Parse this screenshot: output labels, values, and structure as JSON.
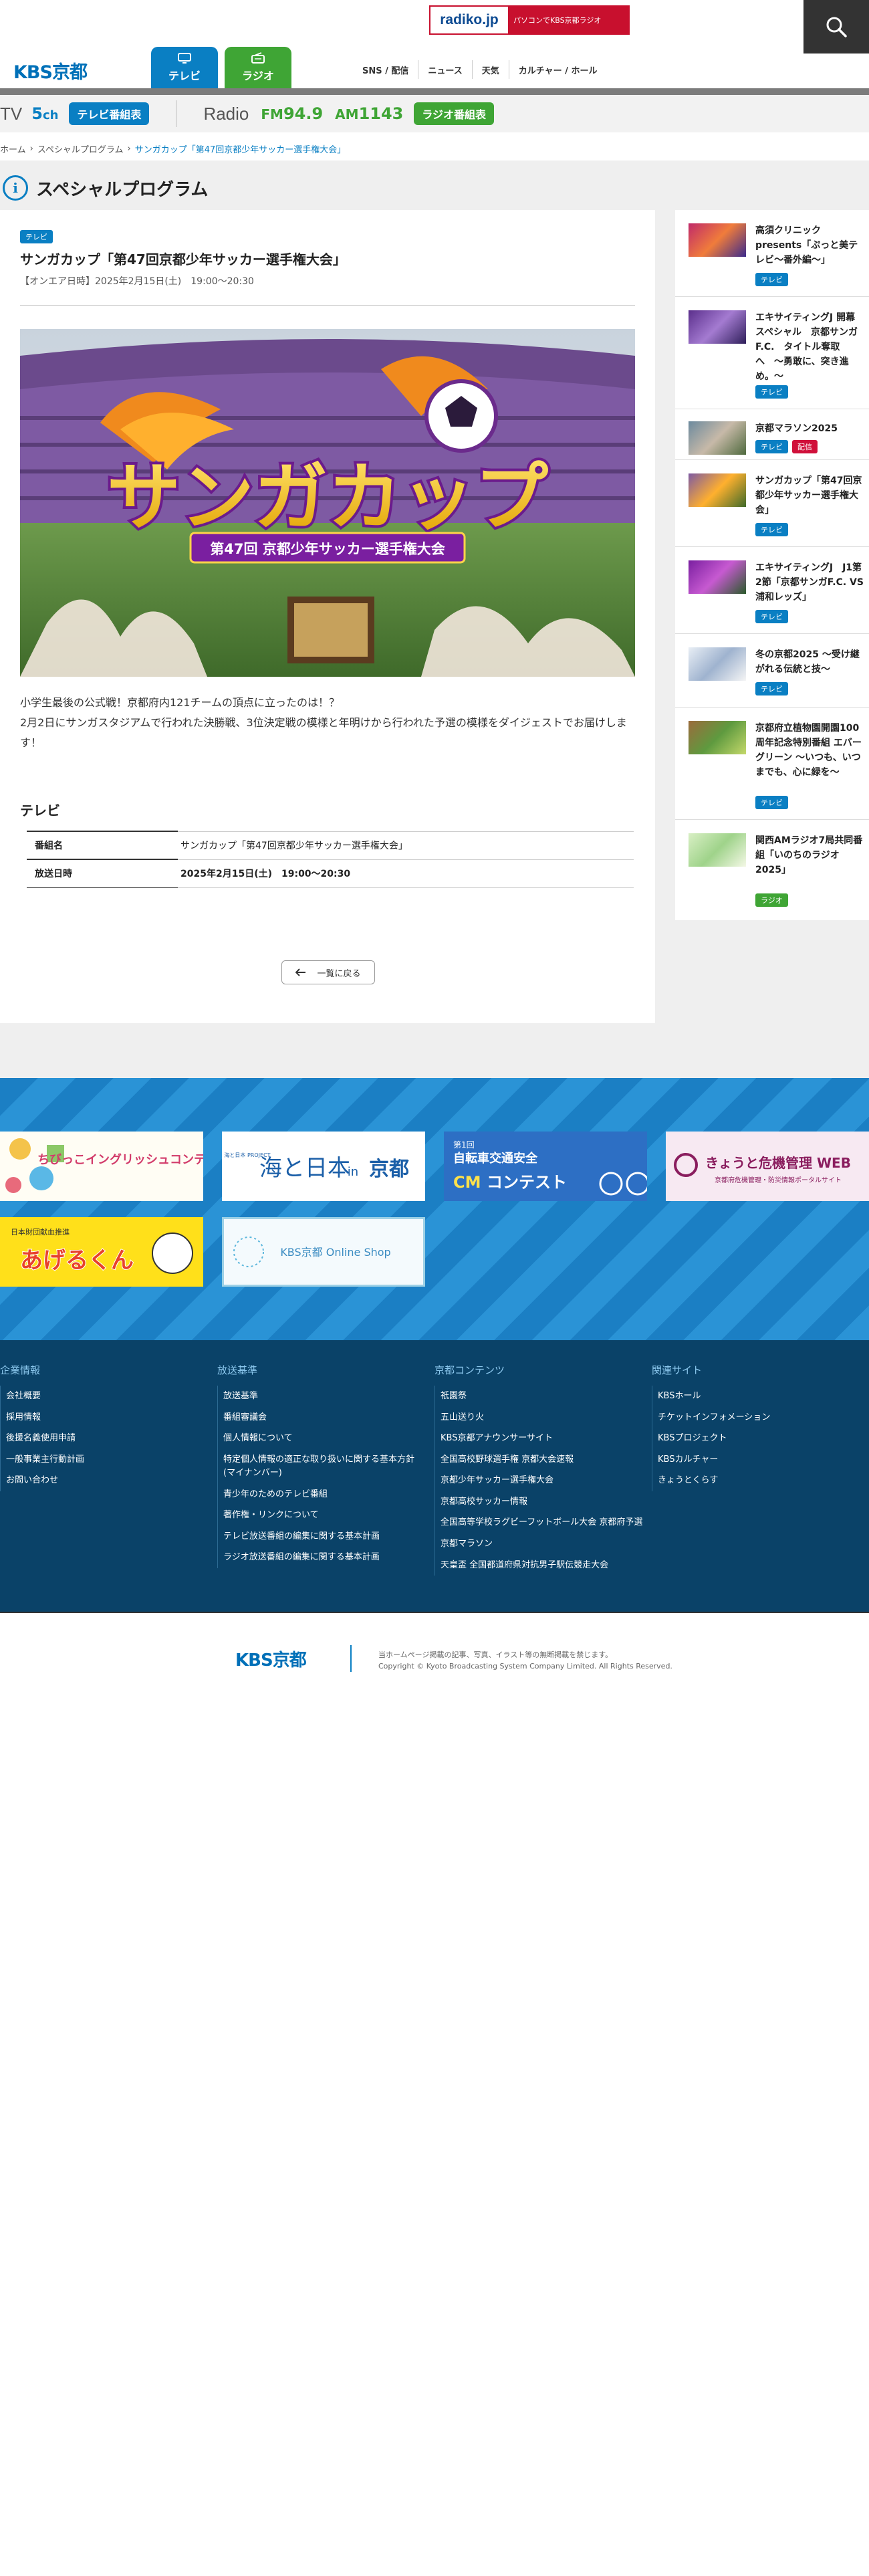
{
  "header": {
    "radiko_logo": "radiko.jp",
    "radiko_text": "パソコンでKBS京都ラジオ",
    "logo": "KBS京都",
    "tab_tv": "テレビ",
    "tab_radio": "ラジオ",
    "gnav": [
      "SNS / 配信",
      "ニュース",
      "天気",
      "カルチャー / ホール"
    ]
  },
  "channel": {
    "tv_label": "TV",
    "tv_channel": "5",
    "tv_channel_unit": "ch",
    "tv_schedule": "テレビ番組表",
    "radio_label": "Radio",
    "fm_label": "FM",
    "fm_freq": "94.9",
    "am_label": "AM",
    "am_freq": "1143",
    "radio_schedule": "ラジオ番組表"
  },
  "breadcrumb": {
    "home": "ホーム",
    "category": "スペシャルプログラム",
    "current": "サンガカップ「第47回京都少年サッカー選手権大会」"
  },
  "section_title": "スペシャルプログラム",
  "article": {
    "tag": "テレビ",
    "title": "サンガカップ「第47回京都少年サッカー選手権大会」",
    "air_date": "【オンエア日時】2025年2月15日(土)　19:00〜20:30",
    "hero_title": "サンガカップ",
    "hero_subtitle": "第47回 京都少年サッカー選手権大会",
    "desc_1": "小学生最後の公式戦！京都府内121チームの頂点に立ったのは！？",
    "desc_2": "2月2日にサンガスタジアムで行われた決勝戦、3位決定戦の模様と年明けから行われた予選の模様をダイジェストでお届けします！",
    "tv_heading": "テレビ",
    "table": [
      {
        "label": "番組名",
        "value": "サンガカップ「第47回京都少年サッカー選手権大会」"
      },
      {
        "label": "放送日時",
        "value": "2025年2月15日(土)　19:00〜20:30"
      }
    ],
    "back": "一覧に戻る"
  },
  "sidebar": [
    {
      "title": "高須クリニック presents「ぷっと美テレビ〜番外編〜」",
      "tags": [
        "テレビ"
      ]
    },
    {
      "title": "エキサイティングJ 開幕スペシャル　京都サンガF.C.　タイトル奪取へ　〜勇敢に、突き進め。〜",
      "tags": [
        "テレビ"
      ]
    },
    {
      "title": "京都マラソン2025",
      "tags": [
        "テレビ",
        "配信"
      ]
    },
    {
      "title": "サンガカップ「第47回京都少年サッカー選手権大会」",
      "tags": [
        "テレビ"
      ]
    },
    {
      "title": "エキサイティングJ　J1第2節「京都サンガF.C. VS 浦和レッズ」",
      "tags": [
        "テレビ"
      ]
    },
    {
      "title": "冬の京都2025 〜受け継がれる伝統と技〜",
      "tags": [
        "テレビ"
      ]
    },
    {
      "title": "京都府立植物園開園100周年記念特別番組 エバーグリーン 〜いつも、いつまでも、心に緑を〜",
      "tags": [
        "テレビ"
      ]
    },
    {
      "title": "関西AMラジオ7局共同番組「いのちのラジオ2025」",
      "tags": [
        "ラジオ"
      ]
    }
  ],
  "banners": {
    "english": "ちびっこイングリッシュコンテスト",
    "umi_small": "海と日本 PROJECT",
    "umi_main": "海と日本",
    "umi_in": "in",
    "umi_kyoto": "京都",
    "bicycle_top": "第1回",
    "bicycle_main": "自転車交通安全",
    "bicycle_cm": "CM",
    "bicycle_contest": "コンテスト",
    "kikikanri": "きょうと危機管理 WEB",
    "kikikanri_sub": "京都府危機管理・防災情報ポータルサイト",
    "ageruku_small": "日本財団献血推進",
    "ageruku_main": "あげるくん",
    "shop": "KBS京都 Online Shop"
  },
  "footer": {
    "col1_title": "企業情報",
    "col1": [
      "会社概要",
      "採用情報",
      "後援名義使用申請",
      "一般事業主行動計画",
      "お問い合わせ"
    ],
    "col2_title": "放送基準",
    "col2": [
      "放送基準",
      "番組審議会",
      "個人情報について",
      "特定個人情報の適正な取り扱いに関する基本方針(マイナンバー)",
      "青少年のためのテレビ番組",
      "著作権・リンクについて",
      "テレビ放送番組の編集に関する基本計画",
      "ラジオ放送番組の編集に関する基本計画"
    ],
    "col3_title": "京都コンテンツ",
    "col3": [
      "祇園祭",
      "五山送り火",
      "KBS京都アナウンサーサイト",
      "全国高校野球選手権 京都大会速報",
      "京都少年サッカー選手権大会",
      "京都高校サッカー情報",
      "全国高等学校ラグビーフットボール大会 京都府予選",
      "京都マラソン",
      "天皇盃 全国都道府県対抗男子駅伝競走大会"
    ],
    "col4_title": "関連サイト",
    "col4": [
      "KBSホール",
      "チケットインフォメーション",
      "KBSプロジェクト",
      "KBSカルチャー",
      "きょうとくらす"
    ],
    "logo": "KBS京都",
    "note_1": "当ホームページ掲載の記事、写真、イラスト等の無断掲載を禁じます。",
    "note_2": "Copyright © Kyoto Broadcasting System Company Limited. All Rights Reserved."
  },
  "colors": {
    "tv_blue": "#0a7fc3",
    "radio_green": "#3fa535",
    "footer_navy": "#0a4268"
  }
}
